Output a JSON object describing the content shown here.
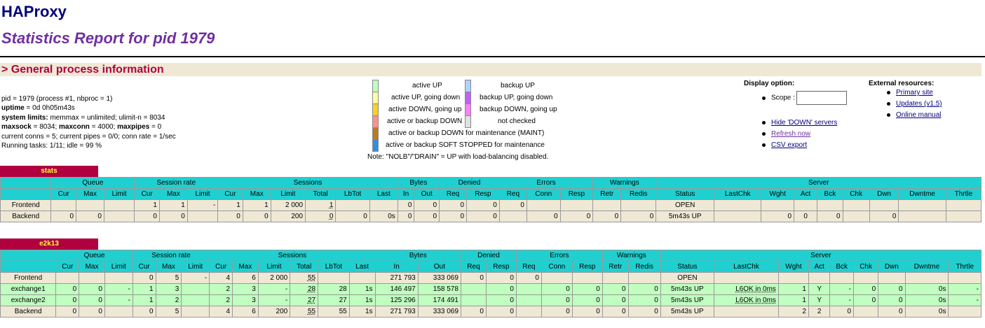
{
  "header": {
    "title": "HAProxy",
    "subtitle": "Statistics Report for pid 1979",
    "section": "> General process information"
  },
  "process_info": {
    "line1": "pid = 1979 (process #1, nbproc = 1)",
    "uptime_label": "uptime",
    "uptime_val": " = 0d 0h05m43s",
    "limits_label": "system limits:",
    "limits_val": " memmax = unlimited; ulimit-n = 8034",
    "maxsock_label": "maxsock",
    "maxsock_val": " = 8034; ",
    "maxconn_label": "maxconn",
    "maxconn_val": " = 4000; ",
    "maxpipes_label": "maxpipes",
    "maxpipes_val": " = 0",
    "line5": "current conns = 5; current pipes = 0/0; conn rate = 1/sec",
    "line6": "Running tasks: 1/11; idle = 99 %"
  },
  "legend": {
    "items": [
      {
        "label": "active UP",
        "color": "#c0ffc0"
      },
      {
        "label": "active UP, going down",
        "color": "#ffffa0"
      },
      {
        "label": "active DOWN, going up",
        "color": "#ffd020"
      },
      {
        "label": "active or backup DOWN",
        "color": "#ff9090"
      },
      {
        "label": "active or backup DOWN for maintenance (MAINT)",
        "color": "#c07820"
      },
      {
        "label": "active or backup SOFT STOPPED for maintenance",
        "color": "#3090e0"
      },
      {
        "label": "backup UP",
        "color": "#b0d0ff"
      },
      {
        "label": "backup UP, going down",
        "color": "#c060ff"
      },
      {
        "label": "backup DOWN, going up",
        "color": "#ff80ff"
      },
      {
        "label": "not checked",
        "color": "#e0e0e0"
      }
    ],
    "note": "Note: \"NOLB\"/\"DRAIN\" = UP with load-balancing disabled."
  },
  "display_options": {
    "title": "Display option:",
    "scope_label": "Scope :",
    "scope_value": "",
    "links": [
      "Hide 'DOWN' servers",
      "Refresh now",
      "CSV export"
    ]
  },
  "external": {
    "title": "External resources:",
    "links": [
      "Primary site",
      "Updates (v1.5)",
      "Online manual"
    ]
  },
  "group_headers": {
    "queue": "Queue",
    "session_rate": "Session rate",
    "sessions": "Sessions",
    "bytes": "Bytes",
    "denied": "Denied",
    "errors": "Errors",
    "warnings": "Warnings",
    "server": "Server"
  },
  "columns": [
    "Cur",
    "Max",
    "Limit",
    "Cur",
    "Max",
    "Limit",
    "Cur",
    "Max",
    "Limit",
    "Total",
    "LbTot",
    "Last",
    "In",
    "Out",
    "Req",
    "Resp",
    "Req",
    "Conn",
    "Resp",
    "Retr",
    "Redis",
    "Status",
    "LastChk",
    "Wght",
    "Act",
    "Bck",
    "Chk",
    "Dwn",
    "Dwntme",
    "Thrtle"
  ],
  "proxies": [
    {
      "name": "stats",
      "rows": [
        {
          "kind": "fe",
          "cells": [
            "Frontend",
            "",
            "",
            "",
            "1",
            "1",
            "-",
            "1",
            "1",
            "2 000",
            "1",
            "",
            "",
            "0",
            "0",
            "0",
            "0",
            "0",
            "",
            "",
            "",
            "",
            "OPEN",
            "",
            "",
            "",
            "",
            "",
            "",
            "",
            ""
          ]
        },
        {
          "kind": "be",
          "cells": [
            "Backend",
            "0",
            "0",
            "",
            "0",
            "0",
            "",
            "0",
            "0",
            "200",
            "0",
            "0",
            "0s",
            "0",
            "0",
            "0",
            "0",
            "",
            "0",
            "0",
            "0",
            "0",
            "5m43s UP",
            "",
            "0",
            "0",
            "0",
            "",
            "0",
            "",
            ""
          ]
        }
      ]
    },
    {
      "name": "e2k13",
      "rows": [
        {
          "kind": "fe",
          "cells": [
            "Frontend",
            "",
            "",
            "",
            "0",
            "5",
            "-",
            "4",
            "6",
            "2 000",
            "55",
            "",
            "",
            "271 793",
            "333 069",
            "0",
            "0",
            "0",
            "",
            "",
            "",
            "",
            "OPEN",
            "",
            "",
            "",
            "",
            "",
            "",
            "",
            ""
          ]
        },
        {
          "kind": "sv",
          "cells": [
            "exchange1",
            "0",
            "0",
            "-",
            "1",
            "3",
            "",
            "2",
            "3",
            "-",
            "28",
            "28",
            "1s",
            "146 497",
            "158 578",
            "",
            "0",
            "",
            "0",
            "0",
            "0",
            "0",
            "5m43s UP",
            "L6OK in 0ms",
            "1",
            "Y",
            "-",
            "0",
            "0",
            "0s",
            "-"
          ]
        },
        {
          "kind": "sv",
          "cells": [
            "exchange2",
            "0",
            "0",
            "-",
            "1",
            "2",
            "",
            "2",
            "3",
            "-",
            "27",
            "27",
            "1s",
            "125 296",
            "174 491",
            "",
            "0",
            "",
            "0",
            "0",
            "0",
            "0",
            "5m43s UP",
            "L6OK in 0ms",
            "1",
            "Y",
            "-",
            "0",
            "0",
            "0s",
            "-"
          ]
        },
        {
          "kind": "be",
          "cells": [
            "Backend",
            "0",
            "0",
            "",
            "0",
            "5",
            "",
            "4",
            "6",
            "200",
            "55",
            "55",
            "1s",
            "271 793",
            "333 069",
            "0",
            "0",
            "",
            "0",
            "0",
            "0",
            "0",
            "5m43s UP",
            "",
            "2",
            "2",
            "0",
            "",
            "0",
            "0s",
            ""
          ]
        }
      ]
    }
  ]
}
